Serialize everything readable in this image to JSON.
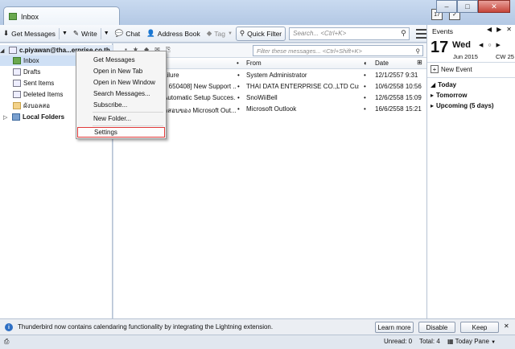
{
  "window": {
    "tab_title": "Inbox",
    "controls": {
      "minimize": "–",
      "maximize": "□",
      "close": "✕"
    }
  },
  "toolbar": {
    "get_messages": "Get Messages",
    "write": "Write",
    "chat": "Chat",
    "address_book": "Address Book",
    "tag": "Tag",
    "quick_filter": "Quick Filter",
    "search_placeholder": "Search... <Ctrl+K>"
  },
  "folders": {
    "account": "c.piyawan@tha...erprise.co.th",
    "items": [
      "Inbox",
      "Drafts",
      "Sent Items",
      "Deleted Items",
      "ผังบอลสอ"
    ],
    "local": "Local Folders"
  },
  "message_pane": {
    "filter_placeholder": "Filter these messages... <Ctrl+Shift+K>",
    "columns": {
      "from": "From",
      "date": "Date"
    },
    "rows": [
      {
        "subject": "ailure",
        "from": "System Administrator",
        "date": "12/1/2557 9:31"
      },
      {
        "subject": "[: 650408] New Support ...",
        "from": "THAI DATA ENTERPRISE CO.,LTD Custom...",
        "date": "10/6/2558 10:56"
      },
      {
        "subject": "Automatic Setup Succes...",
        "from": "SnoWiiBell",
        "date": "12/6/2558 15:09"
      },
      {
        "subject": "ดสอบของ Microsoft Out...",
        "from": "Microsoft Outlook",
        "date": "16/6/2558 15:21"
      }
    ]
  },
  "context_menu": {
    "items": [
      "Get Messages",
      "Open in New Tab",
      "Open in New Window",
      "Search Messages...",
      "Subscribe...",
      "New Folder...",
      "Settings"
    ]
  },
  "events": {
    "title": "Events",
    "day": "17",
    "weekday": "Wed",
    "month_year": "Jun 2015",
    "cw": "CW 25",
    "new_event": "New Event",
    "groups": [
      "Today",
      "Tomorrow",
      "Upcoming (5 days)"
    ]
  },
  "notification": {
    "text": "Thunderbird now contains calendaring functionality by integrating the Lightning extension.",
    "learn_more": "Learn more",
    "disable": "Disable",
    "keep": "Keep"
  },
  "status": {
    "unread": "Unread: 0",
    "total": "Total: 4",
    "today_pane": "Today Pane"
  }
}
